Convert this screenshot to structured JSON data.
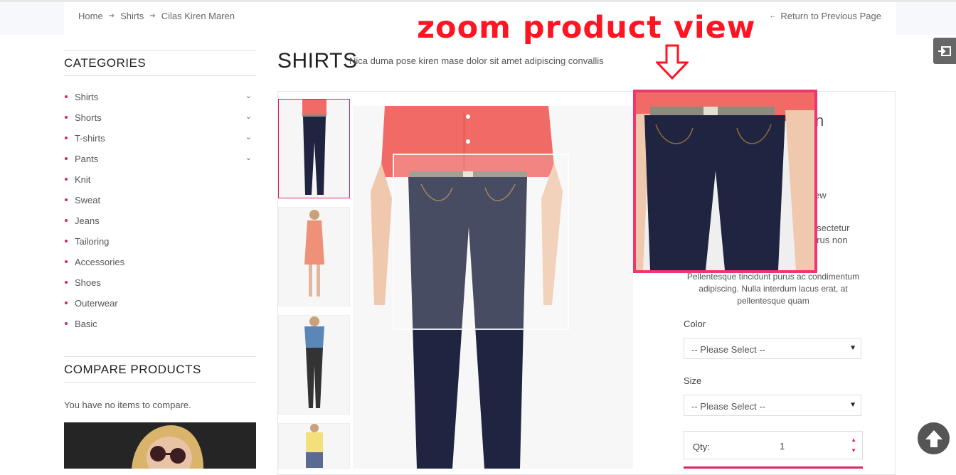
{
  "breadcrumb": {
    "items": [
      "Home",
      "Shirts",
      "Cilas Kiren Maren"
    ],
    "separator": "➔"
  },
  "return_link": {
    "label": "Return to Previous Page"
  },
  "annotation": {
    "title": "zoom product view",
    "color": "#ff1522"
  },
  "sidebar": {
    "categories_title": "CATEGORIES",
    "categories": [
      {
        "label": "Shirts",
        "expandable": true
      },
      {
        "label": "Shorts",
        "expandable": true
      },
      {
        "label": "T-shirts",
        "expandable": true
      },
      {
        "label": "Pants",
        "expandable": true
      },
      {
        "label": "Knit",
        "expandable": false
      },
      {
        "label": "Sweat",
        "expandable": false
      },
      {
        "label": "Jeans",
        "expandable": false
      },
      {
        "label": "Tailoring",
        "expandable": false
      },
      {
        "label": "Accessories",
        "expandable": false
      },
      {
        "label": "Shoes",
        "expandable": false
      },
      {
        "label": "Outerwear",
        "expandable": false
      },
      {
        "label": "Basic",
        "expandable": false
      }
    ],
    "compare_title": "COMPARE PRODUCTS",
    "compare_text": "You have no items to compare."
  },
  "main": {
    "title": "SHIRTS",
    "subtitle": "Nica duma pose kiren mase dolor sit amet adipiscing convallis"
  },
  "product": {
    "name_fragment": "n",
    "review_fragment": "ew",
    "desc_fragment_1": "nsectetur",
    "desc_fragment_2": "urus non",
    "description": "Pellentesque tincidunt purus ac condimentum adipiscing. Nulla interdum lacus erat, at pellentesque quam",
    "color_label": "Color",
    "color_value": "-- Please Select --",
    "size_label": "Size",
    "size_value": "-- Please Select --",
    "qty_label": "Qty:",
    "qty_value": "1"
  },
  "colors": {
    "accent": "#e0245e",
    "zoom_border": "#f0366c",
    "shirt": "#f06a66",
    "denim": "#1f2540"
  }
}
